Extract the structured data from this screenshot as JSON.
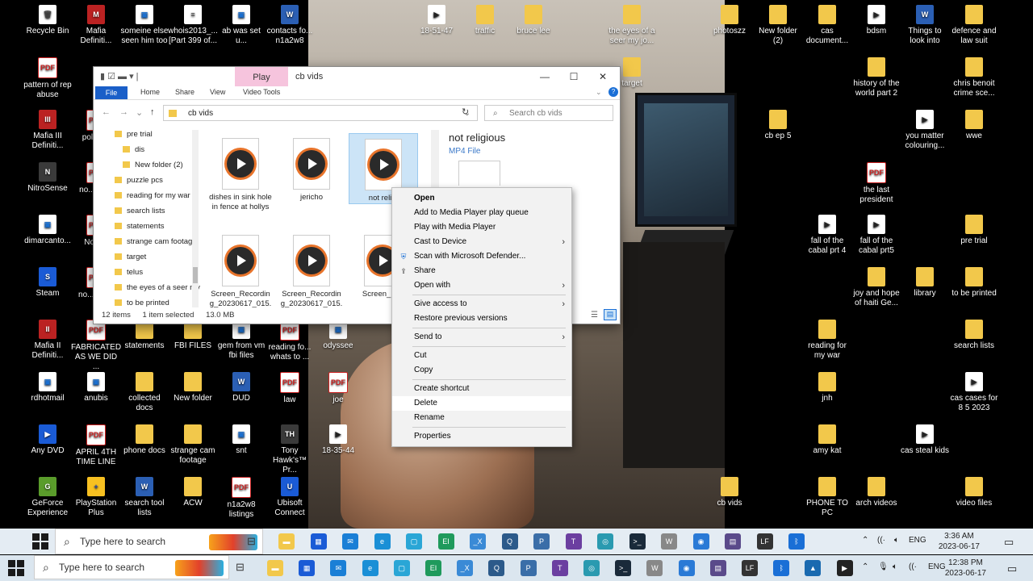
{
  "desktop_icons": [
    {
      "label": "Recycle Bin",
      "icon": "recycle-bin-icon",
      "glyph": "🗑",
      "type": "doc"
    },
    {
      "label": "Mafia Definiti...",
      "icon": "game-icon",
      "glyph": "M",
      "type": "red"
    },
    {
      "label": "someine else seen him too",
      "icon": "image-icon",
      "glyph": "▣",
      "type": "img"
    },
    {
      "label": "whois2013_... [Part 399 of...",
      "icon": "document-icon",
      "glyph": "≡",
      "type": "doc"
    },
    {
      "label": "ab was set u...",
      "icon": "image-icon",
      "glyph": "▣",
      "type": "img"
    },
    {
      "label": "contacts fo... n1a2w8",
      "icon": "word-icon",
      "glyph": "W",
      "type": "word"
    },
    {
      "label": "pattern of rep abuse",
      "icon": "pdf-icon",
      "glyph": "PDF",
      "type": "pdf"
    },
    {
      "label": "Mafia III Definiti...",
      "icon": "game-icon",
      "glyph": "III",
      "type": "red"
    },
    {
      "label": "police...",
      "icon": "pdf-icon",
      "glyph": "PDF",
      "type": "pdf"
    },
    {
      "label": "NitroSense",
      "icon": "nitrosense-icon",
      "glyph": "N",
      "type": "app"
    },
    {
      "label": "no... nu...",
      "icon": "pdf-icon",
      "glyph": "PDF",
      "type": "pdf"
    },
    {
      "label": "dimarcanto...",
      "icon": "image-icon",
      "glyph": "▣",
      "type": "img"
    },
    {
      "label": "Note...",
      "icon": "pdf-icon",
      "glyph": "PDF",
      "type": "pdf"
    },
    {
      "label": "Steam",
      "icon": "steam-icon",
      "glyph": "S",
      "type": "blue"
    },
    {
      "label": "no... tim...",
      "icon": "pdf-icon",
      "glyph": "PDF",
      "type": "pdf"
    },
    {
      "label": "Mafia II Definiti...",
      "icon": "game-icon",
      "glyph": "II",
      "type": "red"
    },
    {
      "label": "FABRICATED AS WE DID ...",
      "icon": "pdf-icon",
      "glyph": "PDF",
      "type": "pdf"
    },
    {
      "label": "statements",
      "icon": "folder-icon",
      "glyph": "",
      "type": "folder"
    },
    {
      "label": "FBI FILES",
      "icon": "folder-icon",
      "glyph": "",
      "type": "folder"
    },
    {
      "label": "gem from vm fbi files",
      "icon": "image-icon",
      "glyph": "▣",
      "type": "img"
    },
    {
      "label": "reading fo... whats to ...",
      "icon": "pdf-icon",
      "glyph": "PDF",
      "type": "pdf"
    },
    {
      "label": "odyssee",
      "icon": "image-icon",
      "glyph": "▣",
      "type": "img"
    },
    {
      "label": "rdhotmail",
      "icon": "image-icon",
      "glyph": "▣",
      "type": "img"
    },
    {
      "label": "anubis",
      "icon": "image-icon",
      "glyph": "▣",
      "type": "img"
    },
    {
      "label": "collected docs",
      "icon": "folder-icon",
      "glyph": "",
      "type": "folder"
    },
    {
      "label": "New folder",
      "icon": "folder-icon",
      "glyph": "",
      "type": "folder"
    },
    {
      "label": "DUD",
      "icon": "word-icon",
      "glyph": "W",
      "type": "word"
    },
    {
      "label": "law",
      "icon": "pdf-icon",
      "glyph": "PDF",
      "type": "pdf"
    },
    {
      "label": "joe",
      "icon": "pdf-icon",
      "glyph": "PDF",
      "type": "pdf"
    },
    {
      "label": "Any DVD",
      "icon": "anydvd-icon",
      "glyph": "▶",
      "type": "blue"
    },
    {
      "label": "APRIL 4TH TIME LINE",
      "icon": "pdf-icon",
      "glyph": "PDF",
      "type": "pdf"
    },
    {
      "label": "phone docs",
      "icon": "folder-icon",
      "glyph": "",
      "type": "folder"
    },
    {
      "label": "strange cam footage",
      "icon": "folder-icon",
      "glyph": "",
      "type": "folder"
    },
    {
      "label": "snt",
      "icon": "image-icon",
      "glyph": "▣",
      "type": "img"
    },
    {
      "label": "Tony Hawk's™ Pr...",
      "icon": "game-icon",
      "glyph": "TH",
      "type": "app"
    },
    {
      "label": "18-35-44",
      "icon": "video-icon",
      "glyph": "▶",
      "type": "vid"
    },
    {
      "label": "GeForce Experience",
      "icon": "geforce-icon",
      "glyph": "G",
      "type": "green"
    },
    {
      "label": "PlayStation Plus",
      "icon": "playstation-icon",
      "glyph": "+",
      "type": "yellow"
    },
    {
      "label": "search tool lists",
      "icon": "word-icon",
      "glyph": "W",
      "type": "word"
    },
    {
      "label": "ACW",
      "icon": "folder-icon",
      "glyph": "",
      "type": "folder"
    },
    {
      "label": "n1a2w8 listings",
      "icon": "pdf-icon",
      "glyph": "PDF",
      "type": "pdf"
    },
    {
      "label": "Ubisoft Connect",
      "icon": "ubisoft-icon",
      "glyph": "U",
      "type": "blue"
    },
    {
      "label": "18-51-47",
      "icon": "video-icon",
      "glyph": "▶",
      "type": "vid"
    },
    {
      "label": "traffic",
      "icon": "folder-icon",
      "glyph": "",
      "type": "folder"
    },
    {
      "label": "bruce lee",
      "icon": "folder-icon",
      "glyph": "",
      "type": "folder"
    },
    {
      "label": "the eyes of a seer my jo...",
      "icon": "folder-icon",
      "glyph": "",
      "type": "folder"
    },
    {
      "label": "target",
      "icon": "folder-icon",
      "glyph": "",
      "type": "folder"
    },
    {
      "label": "photoszz",
      "icon": "folder-icon",
      "glyph": "",
      "type": "folder"
    },
    {
      "label": "New folder (2)",
      "icon": "folder-icon",
      "glyph": "",
      "type": "folder"
    },
    {
      "label": "cas document...",
      "icon": "folder-icon",
      "glyph": "",
      "type": "folder"
    },
    {
      "label": "bdsm",
      "icon": "video-icon",
      "glyph": "▶",
      "type": "vid"
    },
    {
      "label": "Things to look into",
      "icon": "word-icon",
      "glyph": "W",
      "type": "word"
    },
    {
      "label": "defence and law suit",
      "icon": "folder-icon",
      "glyph": "",
      "type": "folder"
    },
    {
      "label": "history of the world part 2",
      "icon": "folder-icon",
      "glyph": "",
      "type": "folder"
    },
    {
      "label": "chris benoit crime sce...",
      "icon": "folder-icon",
      "glyph": "",
      "type": "folder"
    },
    {
      "label": "cb ep 5",
      "icon": "folder-icon",
      "glyph": "",
      "type": "folder"
    },
    {
      "label": "you matter colouring...",
      "icon": "video-icon",
      "glyph": "▶",
      "type": "vid"
    },
    {
      "label": "wwe",
      "icon": "folder-icon",
      "glyph": "",
      "type": "folder"
    },
    {
      "label": "the last president",
      "icon": "pdf-icon",
      "glyph": "PDF",
      "type": "pdf"
    },
    {
      "label": "fall of the cabal prt 4",
      "icon": "video-icon",
      "glyph": "▶",
      "type": "vid"
    },
    {
      "label": "fall of the cabal prt5",
      "icon": "video-icon",
      "glyph": "▶",
      "type": "vid"
    },
    {
      "label": "pre trial",
      "icon": "folder-icon",
      "glyph": "",
      "type": "folder"
    },
    {
      "label": "joy and hope of haiti   Ge...",
      "icon": "folder-icon",
      "glyph": "",
      "type": "folder"
    },
    {
      "label": "library",
      "icon": "folder-icon",
      "glyph": "",
      "type": "folder"
    },
    {
      "label": "to be printed",
      "icon": "folder-icon",
      "glyph": "",
      "type": "folder"
    },
    {
      "label": "reading for my war",
      "icon": "folder-icon",
      "glyph": "",
      "type": "folder"
    },
    {
      "label": "search lists",
      "icon": "folder-icon",
      "glyph": "",
      "type": "folder"
    },
    {
      "label": "jnh",
      "icon": "folder-icon",
      "glyph": "",
      "type": "folder"
    },
    {
      "label": "cas cases for 8 5 2023",
      "icon": "video-icon",
      "glyph": "▶",
      "type": "vid"
    },
    {
      "label": "amy kat",
      "icon": "folder-icon",
      "glyph": "",
      "type": "folder"
    },
    {
      "label": "cas steal kids",
      "icon": "video-icon",
      "glyph": "▶",
      "type": "vid"
    },
    {
      "label": "cb vids",
      "icon": "folder-icon",
      "glyph": "",
      "type": "folder"
    },
    {
      "label": "PHONE TO PC",
      "icon": "folder-icon",
      "glyph": "",
      "type": "folder"
    },
    {
      "label": "arch videos",
      "icon": "folder-icon",
      "glyph": "",
      "type": "folder"
    },
    {
      "label": "video files",
      "icon": "folder-icon",
      "glyph": "",
      "type": "folder"
    }
  ],
  "explorer": {
    "title": "cb vids",
    "contextual_tab": "Play",
    "ribbon_tabs": [
      "File",
      "Home",
      "Share",
      "View",
      "Video Tools"
    ],
    "address": "cb vids",
    "search_placeholder": "Search cb vids",
    "tree": [
      "pre trial",
      "dis",
      "New folder (2)",
      "puzzle pcs",
      "reading for my war",
      "search lists",
      "statements",
      "strange cam footage",
      "target",
      "telus",
      "the eyes of a seer my",
      "to be printed"
    ],
    "files": [
      {
        "name": "dishes in sink hole in fence at hollys",
        "selected": false
      },
      {
        "name": "jericho",
        "selected": false
      },
      {
        "name": "not reli...",
        "selected": true
      },
      {
        "name": "Screen_Recording_20230617_015...",
        "selected": false
      },
      {
        "name": "Screen_Recording_20230617_015...",
        "selected": false
      },
      {
        "name": "Screen_R...",
        "selected": false
      }
    ],
    "preview_title": "not religious",
    "preview_type": "MP4 File",
    "status_items": "12 items",
    "status_selected": "1 item selected",
    "status_size": "13.0 MB"
  },
  "context_menu": [
    {
      "label": "Open",
      "bold": true
    },
    {
      "label": "Add to Media Player play queue"
    },
    {
      "label": "Play with Media Player"
    },
    {
      "label": "Cast to Device",
      "submenu": true
    },
    {
      "label": "Scan with Microsoft Defender...",
      "icon": "defender-icon"
    },
    {
      "label": "Share",
      "icon": "share-icon"
    },
    {
      "label": "Open with",
      "submenu": true
    },
    {
      "sep": true
    },
    {
      "label": "Give access to",
      "submenu": true
    },
    {
      "label": "Restore previous versions"
    },
    {
      "sep": true
    },
    {
      "label": "Send to",
      "submenu": true
    },
    {
      "sep": true
    },
    {
      "label": "Cut"
    },
    {
      "label": "Copy"
    },
    {
      "sep": true
    },
    {
      "label": "Create shortcut"
    },
    {
      "label": "Delete",
      "hover": true
    },
    {
      "label": "Rename"
    },
    {
      "sep": true
    },
    {
      "label": "Properties"
    }
  ],
  "taskbar_top": {
    "search_placeholder": "Type here to search",
    "time": "3:36 AM",
    "date": "2023-06-17",
    "lang": "ENG"
  },
  "taskbar_bottom": {
    "search_placeholder": "Type here to search",
    "time": "12:38 PM",
    "date": "2023-06-17",
    "lang": "ENG"
  },
  "taskbar_apps": [
    {
      "name": "file-explorer-icon",
      "glyph": "▬",
      "color": "#f2c84b"
    },
    {
      "name": "store-icon",
      "glyph": "▦",
      "color": "#1a5bd6"
    },
    {
      "name": "mail-icon",
      "glyph": "✉",
      "color": "#1a7fd6"
    },
    {
      "name": "edge-icon",
      "glyph": "e",
      "color": "#1a8fd6"
    },
    {
      "name": "window-icon",
      "glyph": "▢",
      "color": "#2aa6d6"
    },
    {
      "name": "excel-icon",
      "glyph": "EI",
      "color": "#1f9a5c"
    },
    {
      "name": "x-icon",
      "glyph": "_X",
      "color": "#3a8ad6"
    },
    {
      "name": "search-app-icon",
      "glyph": "Q",
      "color": "#2c5a8a"
    },
    {
      "name": "pdf-app-icon",
      "glyph": "P",
      "color": "#3a6ea8"
    },
    {
      "name": "teams-icon",
      "glyph": "T",
      "color": "#6b3fa0"
    },
    {
      "name": "app-icon",
      "glyph": "◎",
      "color": "#2a9ab0"
    },
    {
      "name": "terminal-icon",
      "glyph": ">_",
      "color": "#1a2a3a"
    },
    {
      "name": "wand-icon",
      "glyph": "W",
      "color": "#888888"
    },
    {
      "name": "globe-icon",
      "glyph": "◉",
      "color": "#2a7ad6"
    },
    {
      "name": "gallery-icon",
      "glyph": "▤",
      "color": "#5a4a8a"
    },
    {
      "name": "lf-icon",
      "glyph": "LF",
      "color": "#333333"
    },
    {
      "name": "bluetooth-icon",
      "glyph": "ᛒ",
      "color": "#1a6fd6"
    }
  ],
  "taskbar_bottom_extra": [
    {
      "name": "photos-icon",
      "glyph": "▲",
      "color": "#1a6ab0"
    },
    {
      "name": "media-player-icon",
      "glyph": "▶",
      "color": "#222222"
    }
  ]
}
